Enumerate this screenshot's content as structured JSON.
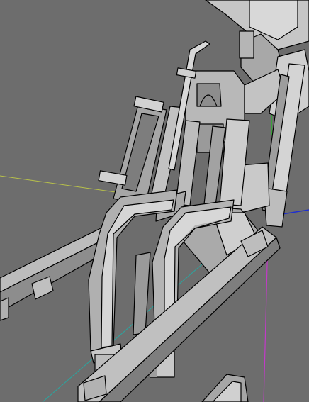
{
  "viewport": {
    "background": "#6d6d6d",
    "face_light": "#cfcfcf",
    "face_mid": "#a9a9a9",
    "face_dark": "#858585",
    "edge_color": "#000000",
    "axes": {
      "x": "#1f2fd0",
      "y": "#18c21a",
      "z": "#c23ac8",
      "ground_line_yellow": "#b8c14a",
      "ground_line_cyan": "#2aa6a0"
    }
  }
}
